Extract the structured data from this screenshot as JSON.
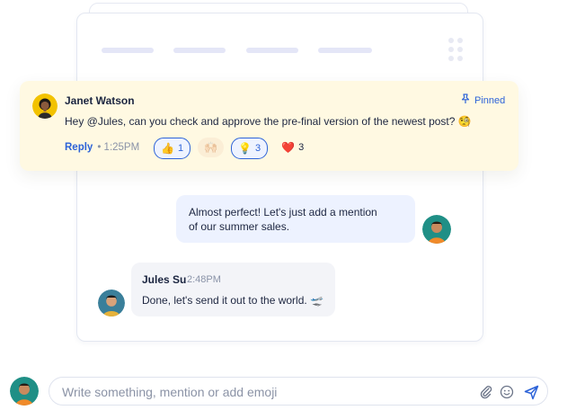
{
  "pinned": {
    "author": "Janet Watson",
    "pinned_label": "Pinned",
    "text": "Hey @Jules, can you check and approve the pre-final version of the newest post? 🧐",
    "reply_label": "Reply",
    "time": "• 1:25PM",
    "reactions": [
      {
        "emoji": "👍",
        "count": "1",
        "active": true
      },
      {
        "emoji": "🙌🏻",
        "count": "",
        "active": false
      },
      {
        "emoji": "💡",
        "count": "3",
        "active": true
      },
      {
        "emoji": "❤️",
        "count": "3",
        "active": false
      }
    ]
  },
  "outgoing": {
    "text_line1": "Almost perfect! Let's just add a mention",
    "text_line2": "of our summer sales."
  },
  "incoming": {
    "author": "Jules Su",
    "time": "2:48PM",
    "text": "Done, let's send it out to the world. 🛫"
  },
  "composer": {
    "placeholder": "Write something, mention or add emoji",
    "value": ""
  },
  "colors": {
    "accent": "#2d63d8",
    "pinned_bg": "#fff9e2",
    "outgoing_bg": "#edf2ff",
    "incoming_bg": "#f3f4f8"
  }
}
